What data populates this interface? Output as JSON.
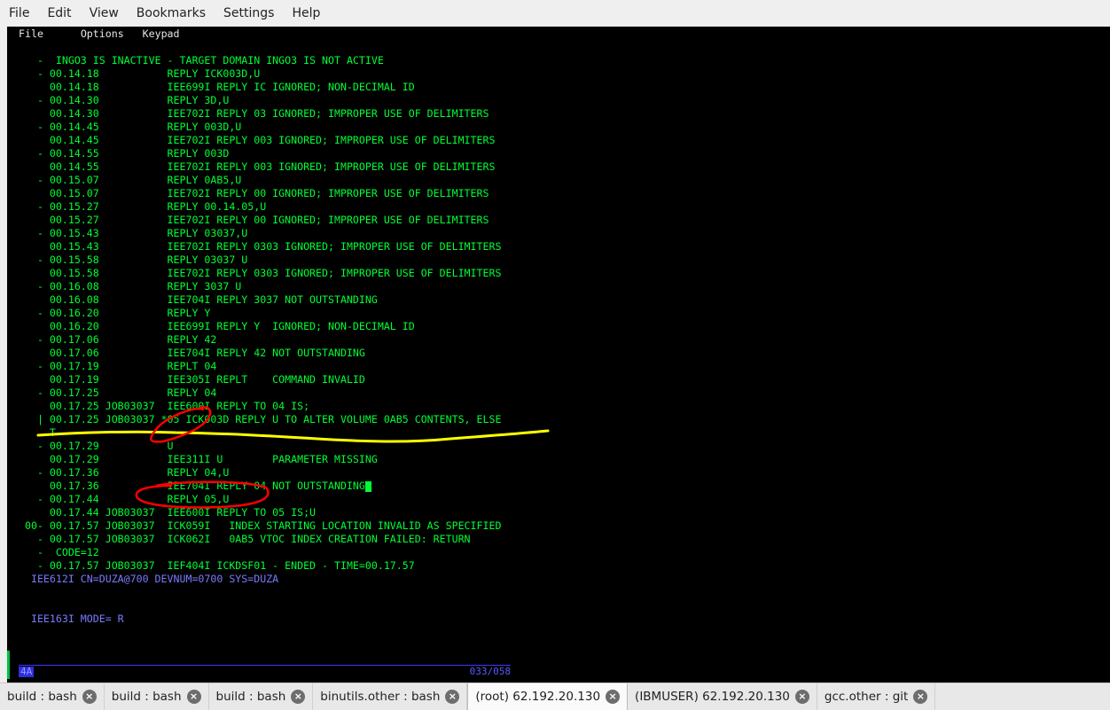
{
  "menubar": [
    "File",
    "Edit",
    "View",
    "Bookmarks",
    "Settings",
    "Help"
  ],
  "terminal": {
    "menu": [
      "File",
      "Options",
      "Keypad"
    ],
    "lines": [
      "   -  INGO3 IS INACTIVE - TARGET DOMAIN INGO3 IS NOT ACTIVE",
      "   - 00.14.18           REPLY ICK003D,U",
      "     00.14.18           IEE699I REPLY IC IGNORED; NON-DECIMAL ID",
      "   - 00.14.30           REPLY 3D,U",
      "     00.14.30           IEE702I REPLY 03 IGNORED; IMPROPER USE OF DELIMITERS",
      "   - 00.14.45           REPLY 003D,U",
      "     00.14.45           IEE702I REPLY 003 IGNORED; IMPROPER USE OF DELIMITERS",
      "   - 00.14.55           REPLY 003D",
      "     00.14.55           IEE702I REPLY 003 IGNORED; IMPROPER USE OF DELIMITERS",
      "   - 00.15.07           REPLY 0AB5,U",
      "     00.15.07           IEE702I REPLY 00 IGNORED; IMPROPER USE OF DELIMITERS",
      "   - 00.15.27           REPLY 00.14.05,U",
      "     00.15.27           IEE702I REPLY 00 IGNORED; IMPROPER USE OF DELIMITERS",
      "   - 00.15.43           REPLY 03037,U",
      "     00.15.43           IEE702I REPLY 0303 IGNORED; IMPROPER USE OF DELIMITERS",
      "   - 00.15.58           REPLY 03037 U",
      "     00.15.58           IEE702I REPLY 0303 IGNORED; IMPROPER USE OF DELIMITERS",
      "   - 00.16.08           REPLY 3037 U",
      "     00.16.08           IEE704I REPLY 3037 NOT OUTSTANDING",
      "   - 00.16.20           REPLY Y",
      "     00.16.20           IEE699I REPLY Y  IGNORED; NON-DECIMAL ID",
      "   - 00.17.06           REPLY 42",
      "     00.17.06           IEE704I REPLY 42 NOT OUTSTANDING",
      "   - 00.17.19           REPLT 04",
      "     00.17.19           IEE305I REPLT    COMMAND INVALID",
      "   - 00.17.25           REPLY 04",
      "     00.17.25 JOB03037  IEE600I REPLY TO 04 IS;",
      "   | 00.17.25 JOB03037 *05 ICK003D REPLY U TO ALTER VOLUME 0AB5 CONTENTS, ELSE",
      "     T",
      "   - 00.17.29           U",
      "     00.17.29           IEE311I U        PARAMETER MISSING",
      "   - 00.17.36           REPLY 04,U",
      "     00.17.36           IEE704I REPLY 04 NOT OUTSTANDING",
      "   - 00.17.44           REPLY 05,U",
      "     00.17.44 JOB03037  IEE600I REPLY TO 05 IS;U",
      " 00- 00.17.57 JOB03037  ICK059I   INDEX STARTING LOCATION INVALID AS SPECIFIED",
      "   - 00.17.57 JOB03037  ICK062I   0AB5 VTOC INDEX CREATION FAILED: RETURN",
      "   -  CODE=12",
      "   - 00.17.57 JOB03037  IEF404I ICKDSF01 - ENDED - TIME=00.17.57"
    ],
    "info_lines": [
      "  IEE612I CN=DUZA@700 DEVNUM=0700 SYS=DUZA",
      "  IEE163I MODE= R"
    ],
    "oia_left": "4A",
    "oia_cursor": "033/058"
  },
  "tabs": [
    {
      "label": "build : bash",
      "active": false
    },
    {
      "label": "build : bash",
      "active": false
    },
    {
      "label": "build : bash",
      "active": false
    },
    {
      "label": "binutils.other : bash",
      "active": false
    },
    {
      "label": "(root) 62.192.20.130",
      "active": true
    },
    {
      "label": "(IBMUSER) 62.192.20.130",
      "active": false
    },
    {
      "label": "gcc.other : git",
      "active": false
    }
  ],
  "colors": {
    "terminal_green": "#00ff33",
    "info_blue": "#7a7aff",
    "annotation_yellow": "#ffff00",
    "annotation_red": "#ff0000"
  }
}
